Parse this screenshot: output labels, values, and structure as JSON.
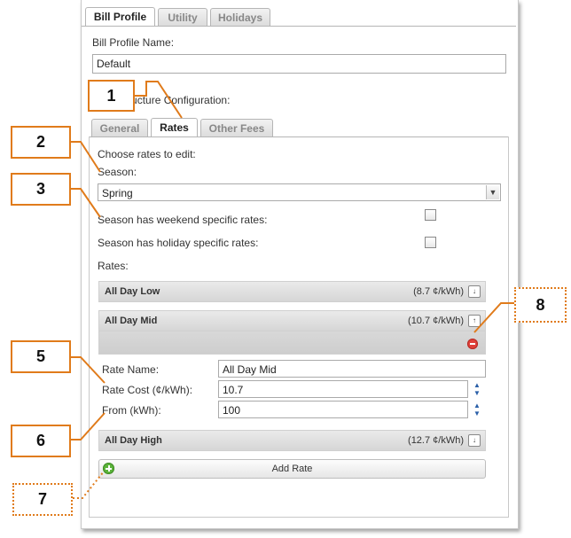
{
  "top_tabs": [
    "Bill Profile",
    "Utility",
    "Holidays"
  ],
  "profile": {
    "name_label": "Bill Profile Name:",
    "name_value": "Default",
    "structure_label": "Rate Structure Configuration:"
  },
  "sub_tabs": [
    "General",
    "Rates",
    "Other Fees"
  ],
  "rates_pane": {
    "choose_label": "Choose rates to edit:",
    "season_label": "Season:",
    "season_value": "Spring",
    "weekend_label": "Season has weekend specific rates:",
    "holiday_label": "Season has holiday specific rates:",
    "rates_label": "Rates:"
  },
  "rates": [
    {
      "name": "All Day Low",
      "rate": "(8.7 ¢/kWh)",
      "expanded": false
    },
    {
      "name": "All Day Mid",
      "rate": "(10.7 ¢/kWh)",
      "expanded": true
    },
    {
      "name": "All Day High",
      "rate": "(12.7 ¢/kWh)",
      "expanded": false
    }
  ],
  "editor": {
    "name_label": "Rate Name:",
    "name_value": "All Day Mid",
    "cost_label": "Rate Cost (¢/kWh):",
    "cost_value": "10.7",
    "from_label": "From (kWh):",
    "from_value": "100"
  },
  "add_rate_label": "Add Rate",
  "callouts": [
    "1",
    "2",
    "3",
    "5",
    "6",
    "7",
    "8"
  ],
  "colors": {
    "callout": "#e07b1b",
    "remove": "#e0413a",
    "add": "#5bb33a"
  }
}
